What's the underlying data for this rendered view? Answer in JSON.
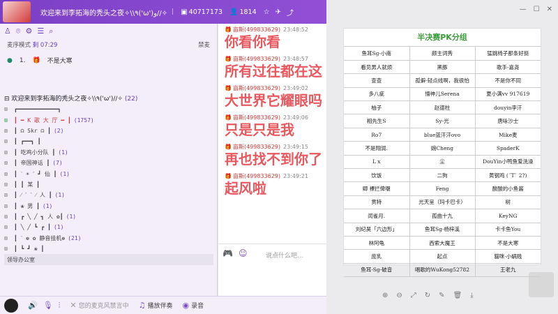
{
  "header": {
    "title": "欢迎来到李拓海的秃头之夜✧\\\\٩('ω')و//✧",
    "room_id": "40717173",
    "online_count": "1814"
  },
  "left": {
    "mode_label": "麦序模式",
    "mode_time": "剩 07:29",
    "mode_right": "禁麦",
    "queue": {
      "index": "1.",
      "name": "不是大寒"
    },
    "channel_title": "欢迎来到李拓海的秃头之夜✧\\\\٩('ω')//✧",
    "channel_count": "(22)",
    "rows": [
      {
        "text": "┏━━━━━━━━━━━━┓",
        "count": ""
      },
      {
        "text": "┃ ━ K 歌 大 厅 ━ ┃",
        "count": "(1757)"
      },
      {
        "text": "┃  ☊  Skr  ☊  ┃",
        "count": "(2)"
      },
      {
        "text": "┃   ┏━━┓   ┃",
        "count": ""
      },
      {
        "text": "┃ 吃鸡小分队    ┃",
        "count": "(1)"
      },
      {
        "text": "┃ 帝国神话      ┃",
        "count": "(7)"
      },
      {
        "text": "┃ ˋ ☀ ˊ ┛ 仙 ┃",
        "count": "(1)"
      },
      {
        "text": "┃  ┃    某  ┃",
        "count": ""
      },
      {
        "text": "┃ ⁄ ˊ  ˋ ⁄  人 ┃",
        "count": "(1)"
      },
      {
        "text": "┃   ❀    男  ┃",
        "count": "(1)"
      },
      {
        "text": "┃ ┏ ╲ ╱ ┓  人 ✿┃",
        "count": "(1)"
      },
      {
        "text": "┃ ╲ ╱ ┗  ┏ ┃",
        "count": "(1)"
      },
      {
        "text": "┃ ˋ ❁ ✿ 静音挂机❁",
        "count": "(21)"
      },
      {
        "text": "┃ ┗ ┛  ❀    ┃",
        "count": ""
      }
    ],
    "office": "领导办公室"
  },
  "chat": {
    "messages": [
      {
        "user": "亩斯(499833629)",
        "time": "23:48:52",
        "text": "你看你看"
      },
      {
        "user": "亩斯(499833629)",
        "time": "23:48:57",
        "text": "所有过往都在这"
      },
      {
        "user": "亩斯(499833629)",
        "time": "23:49:02",
        "text": "大世界它耀眼吗"
      },
      {
        "user": "亩斯(499833629)",
        "time": "23:49:06",
        "text": "只是只是我"
      },
      {
        "user": "亩斯(499833629)",
        "time": "23:49:15",
        "text": "再也找不到你了"
      },
      {
        "user": "亩斯(499833629)",
        "time": "23:49:21",
        "text": "起风啦"
      }
    ],
    "input_placeholder": "说点什么吧..."
  },
  "bottom": {
    "mic_status": "您的麦克风禁言中",
    "play_accompaniment": "播放伴奏",
    "record": "录音"
  },
  "doc": {
    "title": "半决赛PK分组",
    "rows": [
      [
        "鱼耳Sg-小南",
        "颜主词秀",
        "猛跳椅子那条好挺"
      ],
      [
        "看见男人就烦",
        "黑豚",
        "歌手-嘉尧"
      ],
      [
        "查查",
        "孤僻-轻点线啊，我很怕",
        "不是你不同"
      ],
      [
        "多八疵",
        "懵神儿Serena",
        "夏小满vv 917619"
      ],
      [
        "柚子",
        "赵德柱",
        "douyin李汗"
      ],
      [
        "相先生S",
        "Sy-光",
        "唐咏沙士"
      ],
      [
        "Ro7",
        "blue蓝汗汗ovo",
        "Mike麦"
      ],
      [
        "不是翔润.",
        "婉Cheng",
        "SpaderK"
      ],
      [
        "L x",
        "尘",
        "DouYin小鸭鱼爱洗澡"
      ],
      [
        "饮饭",
        "二狗",
        "黄钢鸡 (ˊTˋ 2?)"
      ],
      [
        "卿 裸拦俾嘲",
        "Feng",
        "酸酸的小鱼酱"
      ],
      [
        "贯特",
        "光天呈（玛卡巴卡）",
        "树"
      ],
      [
        "闰雀月.",
        "孤曲十九",
        "KeyNG"
      ],
      [
        "刘纪昊「六边形」",
        "鱼耳Sg-杨梓溪",
        "卡卡鱼You"
      ],
      [
        "林阿龟",
        "西索大魔王",
        "不是大寒"
      ],
      [
        "庞乳",
        "起点",
        "貓咪-小蜗贱"
      ],
      [
        "鱼耳-Sg-破音",
        "唱歌的WuKong52782",
        "王老九"
      ]
    ]
  }
}
